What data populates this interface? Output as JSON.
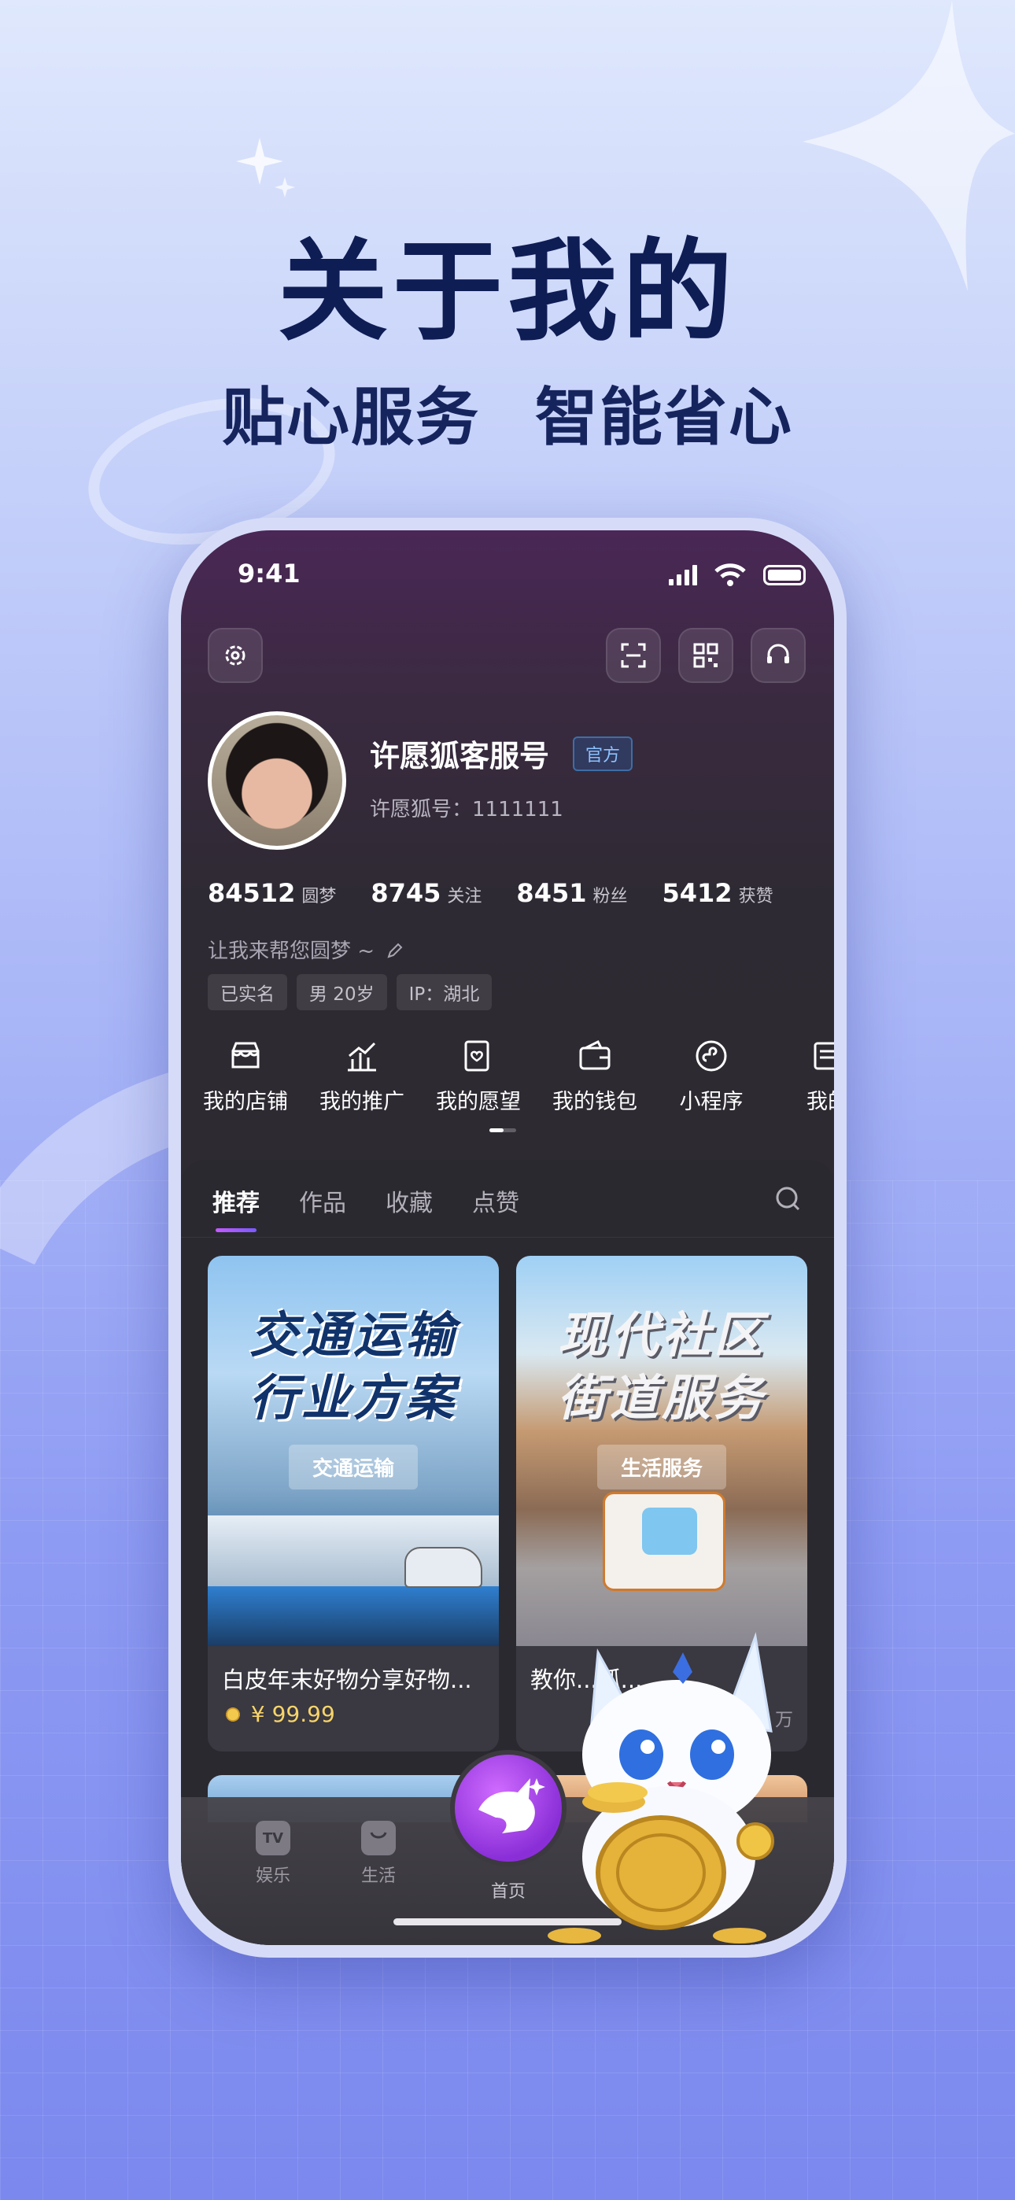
{
  "headline": "关于我的",
  "subline": [
    "贴心服务",
    "智能省心"
  ],
  "status": {
    "time": "9:41"
  },
  "profile": {
    "name": "许愿狐客服号",
    "badge": "官方",
    "id_text": "许愿狐号：1111111",
    "stats": [
      {
        "num": "84512",
        "label": "圆梦"
      },
      {
        "num": "8745",
        "label": "关注"
      },
      {
        "num": "8451",
        "label": "粉丝"
      },
      {
        "num": "5412",
        "label": "获赞"
      }
    ],
    "bio": "让我来帮您圆梦 ~",
    "tags": [
      "已实名",
      "男 20岁",
      "IP：湖北"
    ]
  },
  "shortcuts": [
    {
      "label": "我的店铺",
      "icon": "store-icon"
    },
    {
      "label": "我的推广",
      "icon": "chart-icon"
    },
    {
      "label": "我的愿望",
      "icon": "wish-icon"
    },
    {
      "label": "我的钱包",
      "icon": "wallet-icon"
    },
    {
      "label": "小程序",
      "icon": "miniapp-icon"
    },
    {
      "label": "我的",
      "icon": "list-icon"
    }
  ],
  "tabs": [
    "推荐",
    "作品",
    "收藏",
    "点赞"
  ],
  "cards": [
    {
      "img_title_1": "交通运输",
      "img_title_2": "行业方案",
      "img_badge": "交通运输",
      "title": "白皮年末好物分享好物...",
      "price": "¥ 99.99",
      "meta": ""
    },
    {
      "img_title_1": "现代社区",
      "img_title_2": "街道服务",
      "img_badge": "生活服务",
      "title": "教你...狐...",
      "price": "",
      "meta": "万"
    }
  ],
  "nav": {
    "items": [
      {
        "label": "娱乐",
        "icon_text": "TV"
      },
      {
        "label": "生活",
        "icon_text": ""
      }
    ],
    "home_label": "首页"
  },
  "colors": {
    "accent": "#c35bff",
    "headline": "#0f1d55",
    "price": "#f7d46a"
  }
}
